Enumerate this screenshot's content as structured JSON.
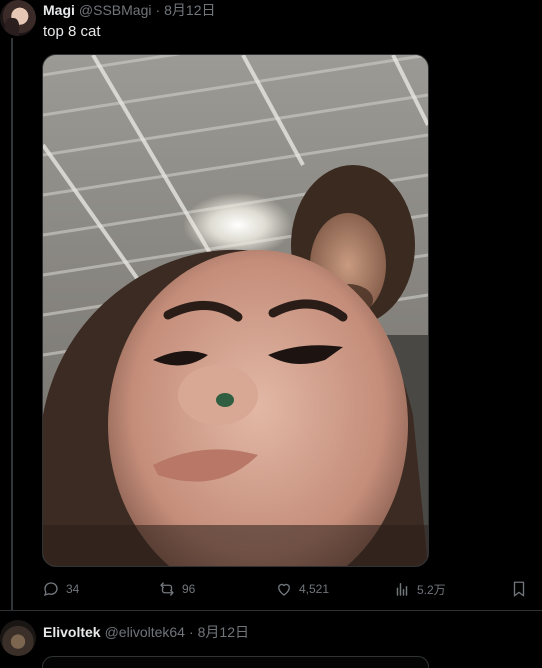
{
  "tweet": {
    "display_name": "Magi",
    "handle": "@SSBMagi",
    "separator": "·",
    "date": "8月12日",
    "text": "top 8 cat",
    "media": {
      "icon": "photo-selfie"
    },
    "actions": {
      "replies": "34",
      "retweets": "96",
      "likes": "4,521",
      "views": "5.2万"
    }
  },
  "reply": {
    "display_name": "Elivoltek",
    "handle": "@elivoltek64",
    "separator": "·",
    "date": "8月12日"
  },
  "colors": {
    "background": "#000000",
    "text_primary": "#e7e9ea",
    "text_secondary": "#71767b",
    "border": "#2f3336"
  }
}
